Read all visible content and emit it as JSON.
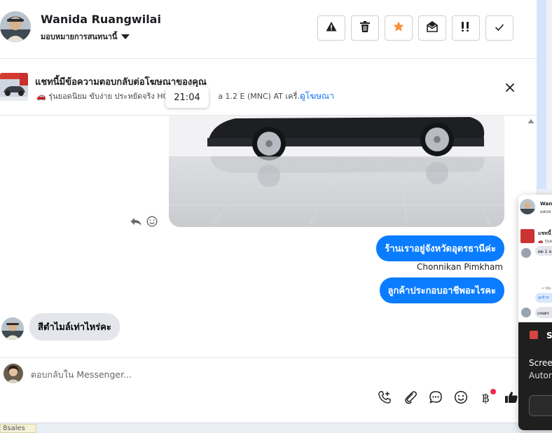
{
  "header": {
    "name": "Wanida Ruangwilai",
    "assign_label": "มอบหมายการสนทนานี้",
    "icons": [
      "warning-icon",
      "trash-icon",
      "star-icon",
      "mark-unread-icon",
      "follow-up-icon",
      "check-icon"
    ],
    "star_color": "#f7923b"
  },
  "ad_banner": {
    "title": "แชทนี้มีข้อความตอบกลับต่อโฆษณาของคุณ",
    "subtitle_left": "🚗 รุ่นยอดนิยม ขับง่าย ประหยัดจริง HO",
    "subtitle_right": "a 1.2 E (MNC) AT เครื่...",
    "link": "ดูโฆษณา",
    "close_icon": "close-icon"
  },
  "tooltip": {
    "time": "21:04"
  },
  "messages": {
    "outgoing": [
      {
        "text": "ร้านเราอยู่จังหวัดอุดรธานีค่ะ"
      },
      {
        "text": "ลูกค้าประกอบอาชีพอะไรคะ"
      }
    ],
    "sender": "Chonnikan Pimkham",
    "incoming": [
      {
        "text": "สีตำไมล์เท่าไหร่คะ"
      }
    ]
  },
  "composer": {
    "placeholder": "ตอบกลับใน Messenger...",
    "tools": [
      "add-call-icon",
      "attachment-icon",
      "saved-reply-icon",
      "emoji-icon",
      "baht-payment-icon",
      "thumbs-up-icon"
    ],
    "baht_symbol": "฿"
  },
  "bottom_tag": "8sales",
  "mini_window": {
    "name": "Wani",
    "sub": "มอบห",
    "ad": "แชทนี้",
    "ad_sub": "🚗 รุ่นย",
    "bubble1": "ตด 1 ล",
    "small": "↩ Wa",
    "bubble2": "ลูกค้าท",
    "bubble3": "เกษตร",
    "dark_label": "Sn",
    "dark_line1": "Scree",
    "dark_line2": "Autor"
  },
  "colors": {
    "accent": "#0a7cff",
    "link": "#1877f2",
    "notification": "#f02849"
  }
}
